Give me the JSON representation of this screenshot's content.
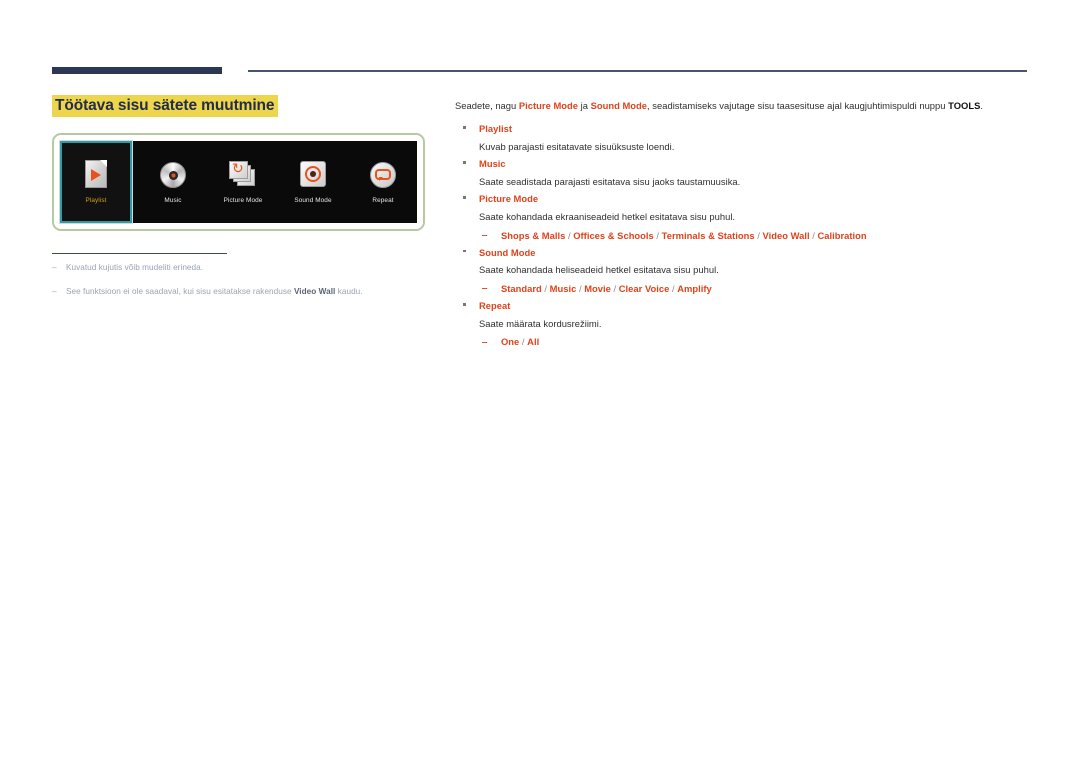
{
  "page": {
    "title": "Töötava sisu sätete muutmine"
  },
  "screenshot": {
    "items": [
      {
        "label": "Playlist",
        "icon": "playlist-page-play-icon",
        "selected": true
      },
      {
        "label": "Music",
        "icon": "music-disc-icon",
        "selected": false
      },
      {
        "label": "Picture Mode",
        "icon": "picture-mode-cards-refresh-icon",
        "selected": false
      },
      {
        "label": "Sound Mode",
        "icon": "sound-mode-dial-icon",
        "selected": false
      },
      {
        "label": "Repeat",
        "icon": "repeat-loop-icon",
        "selected": false
      }
    ]
  },
  "notes": [
    {
      "dash": "‒",
      "text_before": "Kuvatud kujutis võib mudeliti erineda.",
      "bold": "",
      "text_after": ""
    },
    {
      "dash": "‒",
      "text_before": "See funktsioon ei ole saadaval, kui sisu esitatakse rakenduse ",
      "bold": "Video Wall",
      "text_after": " kaudu."
    }
  ],
  "intro": {
    "part1": "Seadete, nagu ",
    "red1": "Picture Mode",
    "part2": " ja ",
    "red2": "Sound Mode",
    "part3": ", seadistamiseks vajutage sisu taasesituse ajal kaugjuhtimispuldi nuppu ",
    "bold1": "TOOLS",
    "part4": "."
  },
  "bullets": [
    {
      "title": "Playlist",
      "desc": "Kuvab parajasti esitatavate sisuüksuste loendi.",
      "sub_dash": "",
      "options": []
    },
    {
      "title": "Music",
      "desc": "Saate seadistada parajasti esitatava sisu jaoks taustamuusika.",
      "sub_dash": "",
      "options": []
    },
    {
      "title": "Picture Mode",
      "desc": "Saate kohandada ekraaniseadeid hetkel esitatava sisu puhul.",
      "sub_dash": "‒",
      "options": [
        "Shops & Malls",
        "Offices & Schools",
        "Terminals & Stations",
        "Video Wall",
        "Calibration"
      ]
    },
    {
      "title": "Sound Mode",
      "desc": "Saate kohandada heliseadeid hetkel esitatava sisu puhul.",
      "sub_dash": "‒",
      "options": [
        "Standard",
        "Music",
        "Movie",
        "Clear Voice",
        "Amplify"
      ]
    },
    {
      "title": "Repeat",
      "desc": "Saate määrata kordusrežiimi.",
      "sub_dash": "‒",
      "options": [
        "One",
        "All"
      ]
    }
  ],
  "colors": {
    "accent_red": "#e0431b",
    "title_highlight": "#edd64b",
    "title_text": "#232c4a",
    "rule_navy": "#2c3655",
    "panel_border_green": "#b6caa0",
    "selection_teal": "#2c9ca8",
    "selected_label_gold": "#d2a011",
    "note_gray": "#9aa2b4"
  }
}
